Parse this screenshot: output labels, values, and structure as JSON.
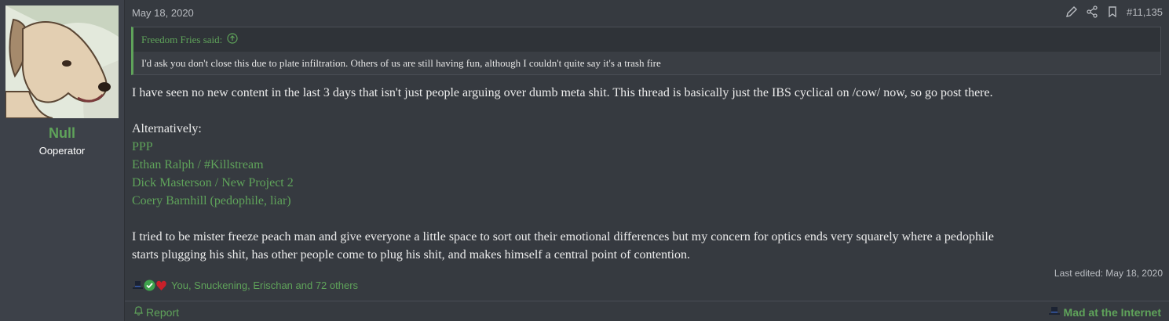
{
  "user": {
    "name": "Null",
    "title": "Ooperator",
    "avatar_icon": "dog-avatar-icon"
  },
  "post": {
    "date": "May 18, 2020",
    "number": "#11,135",
    "tools": [
      "edit-icon",
      "share-icon",
      "bookmark-icon"
    ],
    "quote": {
      "author": "Freedom Fries said:",
      "text": "I'd ask you don't close this due to plate infiltration. Others of us are still having fun, although I couldn't quite say it's a trash fire"
    },
    "body": {
      "p1": "I have seen no new content in the last 3 days that isn't just people arguing over dumb meta shit. This thread is basically just the IBS cyclical on /cow/ now, so go post there.",
      "alt_label": "Alternatively:",
      "links": [
        "PPP",
        "Ethan Ralph / #Killstream",
        "Dick Masterson / New Project 2",
        "Coery Barnhill (pedophile, liar)"
      ],
      "p2_line1": "I tried to be mister freeze peach man and give everyone a little space to sort out their emotional differences but my concern for optics ends very squarely where a pedophile",
      "p2_line2": "starts plugging his shit, has other people come to plug his shit, and makes himself a central point of contention."
    },
    "last_edited": "Last edited: May 18, 2020",
    "reactions_text": "You, Snuckening, Erischan and 72 others",
    "report_label": "Report",
    "reaction_button": "Mad at the Internet"
  },
  "colors": {
    "accent": "#5fa35a",
    "background": "#363a40",
    "sidebar": "#3d4149"
  }
}
